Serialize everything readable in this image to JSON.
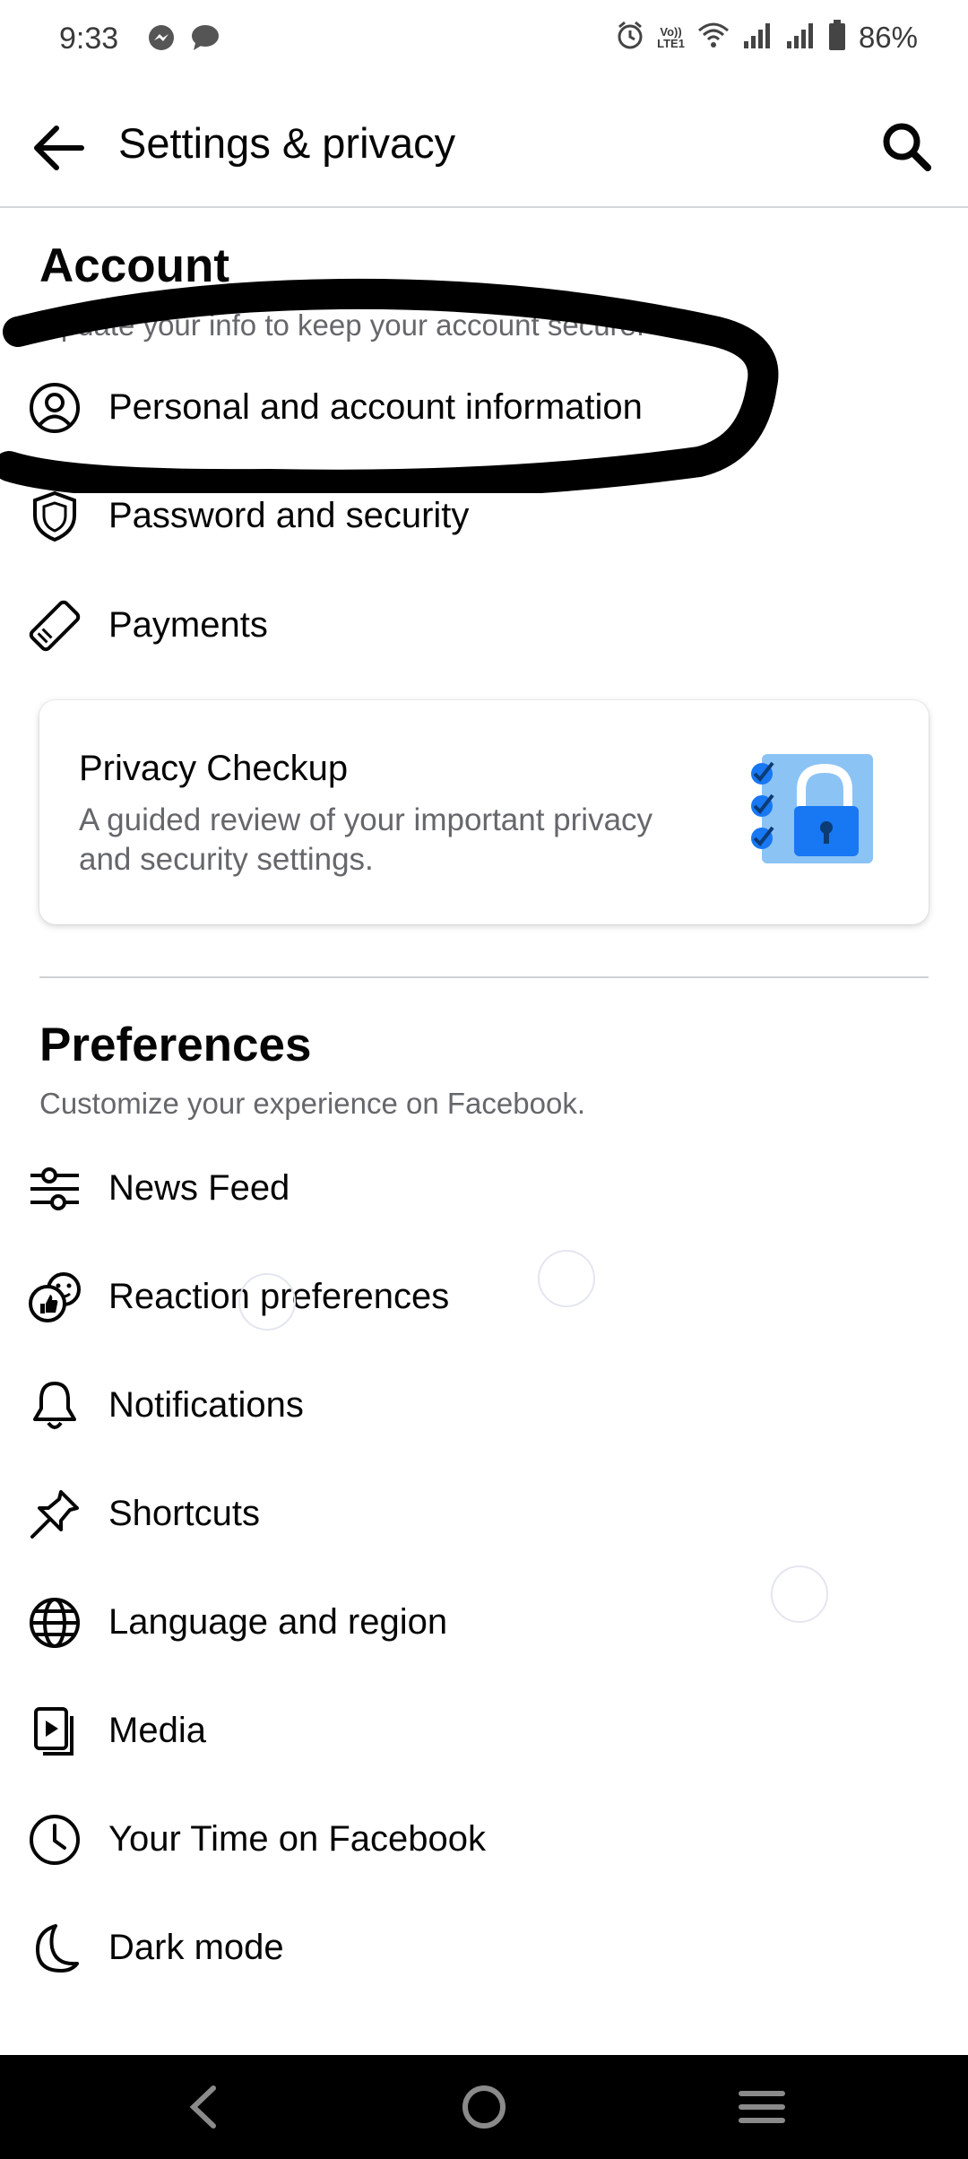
{
  "status_bar": {
    "time": "9:33",
    "battery": "86%",
    "volte_label": "Vo))",
    "lte_label": "LTE1"
  },
  "header": {
    "title": "Settings & privacy"
  },
  "account": {
    "title": "Account",
    "subtitle": "Update your info to keep your account secure.",
    "items": [
      {
        "label": "Personal and account information",
        "icon": "person-circle-icon"
      },
      {
        "label": "Password and security",
        "icon": "shield-icon"
      },
      {
        "label": "Payments",
        "icon": "tag-icon"
      }
    ]
  },
  "privacy_card": {
    "title": "Privacy Checkup",
    "description": "A guided review of your important privacy and security settings.",
    "accent": "#1877f2"
  },
  "preferences": {
    "title": "Preferences",
    "subtitle": "Customize your experience on Facebook.",
    "items": [
      {
        "label": "News Feed",
        "icon": "sliders-icon"
      },
      {
        "label": "Reaction preferences",
        "icon": "reactions-icon"
      },
      {
        "label": "Notifications",
        "icon": "bell-icon"
      },
      {
        "label": "Shortcuts",
        "icon": "pin-icon"
      },
      {
        "label": "Language and region",
        "icon": "globe-icon"
      },
      {
        "label": "Media",
        "icon": "media-icon"
      },
      {
        "label": "Your Time on Facebook",
        "icon": "clock-icon"
      },
      {
        "label": "Dark mode",
        "icon": "moon-icon"
      }
    ]
  }
}
